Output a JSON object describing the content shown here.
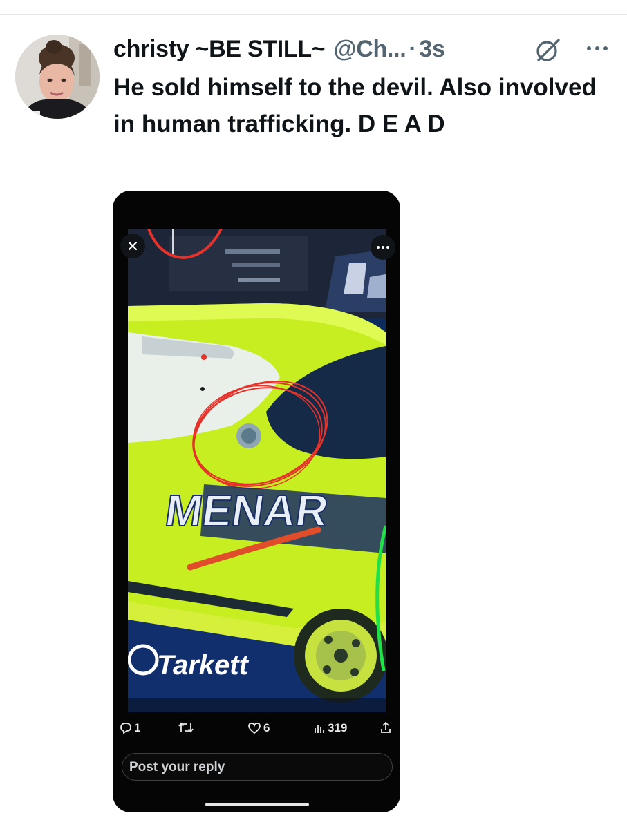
{
  "tweet": {
    "display_name": "christy ~BE STILL~",
    "handle": "@Ch...",
    "separator": "·",
    "timestamp": "3s",
    "text": "He sold himself to the devil. Also involved in human trafficking. D E A D",
    "icons": {
      "avatar": "avatar",
      "grok": "grok-icon",
      "more": "more-icon"
    }
  },
  "embedded_screenshot": {
    "video": {
      "close_icon": "close-icon",
      "more_icon": "more-icon",
      "visible_text": [
        "MENAR",
        "Tarkett"
      ]
    },
    "actions": {
      "reply_count": "1",
      "like_count": "6",
      "views_count": "319",
      "icons": [
        "reply-icon",
        "retweet-icon",
        "like-icon",
        "views-icon",
        "share-icon"
      ]
    },
    "reply_placeholder": "Post your reply"
  },
  "colors": {
    "text_primary": "#0f1419",
    "text_secondary": "#536471",
    "phone_bg": "#050505",
    "car_green": "#c6ee21",
    "annotation_red": "#e5322b",
    "annotation_green": "#22e04a"
  }
}
